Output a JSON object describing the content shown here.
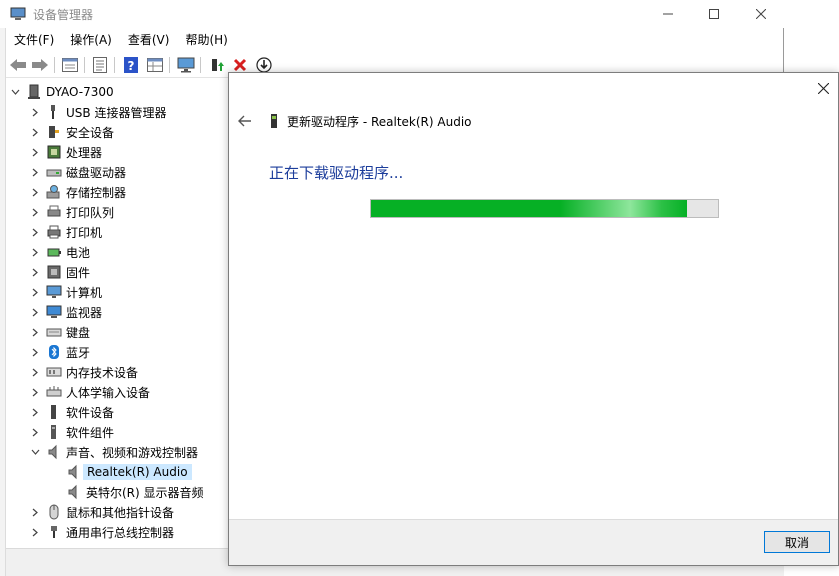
{
  "window": {
    "title": "设备管理器"
  },
  "menu": [
    "文件(F)",
    "操作(A)",
    "查看(V)",
    "帮助(H)"
  ],
  "toolbar": {
    "icons": [
      "back-arrow-icon",
      "forward-arrow-icon",
      "properties-icon",
      "list-icon",
      "help-icon",
      "grid-icon",
      "monitor-scan-icon",
      "update-driver-icon",
      "uninstall-x-icon",
      "download-icon"
    ],
    "uninstall_color": "#d81e1e",
    "help_color": "#2b53c8"
  },
  "tree": {
    "root": "DYAO-7300",
    "items": [
      {
        "label": "USB 连接器管理器",
        "icon": "usb-icon"
      },
      {
        "label": "安全设备",
        "icon": "security-key-icon"
      },
      {
        "label": "处理器",
        "icon": "cpu-icon"
      },
      {
        "label": "磁盘驱动器",
        "icon": "disk-drive-icon"
      },
      {
        "label": "存储控制器",
        "icon": "storage-controller-icon"
      },
      {
        "label": "打印队列",
        "icon": "print-queue-icon"
      },
      {
        "label": "打印机",
        "icon": "printer-icon"
      },
      {
        "label": "电池",
        "icon": "battery-icon"
      },
      {
        "label": "固件",
        "icon": "firmware-icon"
      },
      {
        "label": "计算机",
        "icon": "computer-icon"
      },
      {
        "label": "监视器",
        "icon": "monitor-icon"
      },
      {
        "label": "键盘",
        "icon": "keyboard-icon"
      },
      {
        "label": "蓝牙",
        "icon": "bluetooth-icon"
      },
      {
        "label": "内存技术设备",
        "icon": "memory-icon"
      },
      {
        "label": "人体学输入设备",
        "icon": "hid-icon"
      },
      {
        "label": "软件设备",
        "icon": "software-device-icon"
      },
      {
        "label": "软件组件",
        "icon": "software-component-icon"
      },
      {
        "label": "声音、视频和游戏控制器",
        "icon": "speaker-icon"
      },
      {
        "label": "鼠标和其他指针设备",
        "icon": "mouse-icon"
      },
      {
        "label": "通用串行总线控制器",
        "icon": "usb-controller-icon"
      }
    ],
    "sound_children": [
      {
        "label": "Realtek(R) Audio",
        "icon": "speaker-icon"
      },
      {
        "label": "英特尔(R) 显示器音频",
        "icon": "speaker-icon"
      }
    ]
  },
  "dialog": {
    "title": "更新驱动程序 - Realtek(R) Audio",
    "status": "正在下载驱动程序...",
    "progress": 0.91,
    "cancel_label": "取消",
    "accent": "#1c3d9b",
    "progress_color": "#06b025"
  }
}
